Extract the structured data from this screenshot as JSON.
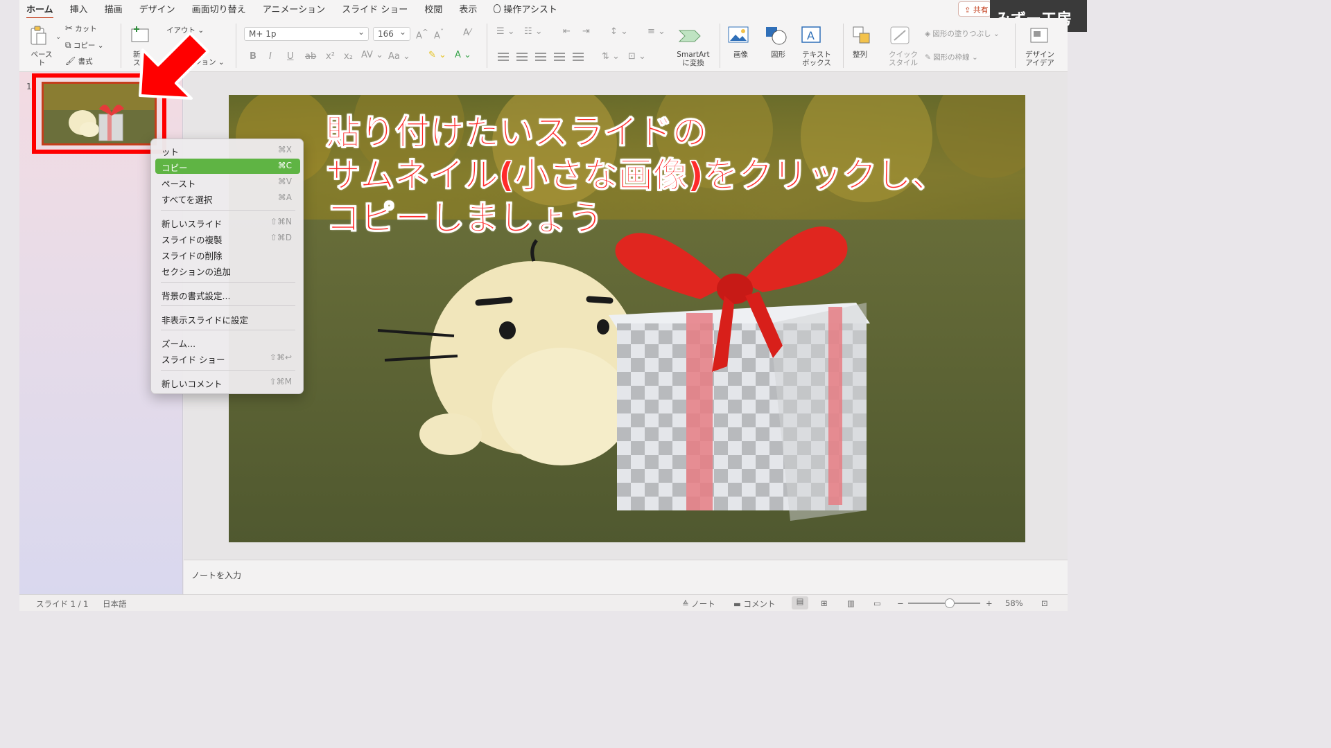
{
  "tabs": [
    {
      "label": "ホーム",
      "active": true
    },
    {
      "label": "挿入"
    },
    {
      "label": "描画"
    },
    {
      "label": "デザイン"
    },
    {
      "label": "画面切り替え"
    },
    {
      "label": "アニメーション"
    },
    {
      "label": "スライド ショー"
    },
    {
      "label": "校閲"
    },
    {
      "label": "表示"
    }
  ],
  "assist_label": "操作アシスト",
  "share_label": "共有",
  "watermark": "みずー工房",
  "ribbon": {
    "paste": "ペースト",
    "cut": "カット",
    "copy": "コピー",
    "format": "書式",
    "new_slide_fragment": "新",
    "new_slide_fragment2": "ス",
    "layout_fragment": "イアウト",
    "section_fragment": "ション",
    "font_name": "M+ 1p",
    "font_size": "166",
    "smartart": "SmartArt\nに変換",
    "image": "画像",
    "shape": "図形",
    "textbox": "テキスト\nボックス",
    "arrange": "整列",
    "quick_style": "クイック\nスタイル",
    "shape_fill": "図形の塗りつぶし",
    "shape_outline": "図形の枠線",
    "design_ideas": "デザイン\nアイデア"
  },
  "slide_number": "1",
  "slide_title": "貼り付けたいスライドの\nサムネイル(小さな画像)をクリックし、\nコピーしましょう",
  "notes_placeholder": "ノートを入力",
  "status": {
    "slide_count": "スライド 1 / 1",
    "language": "日本語",
    "notes": "ノート",
    "comments": "コメント",
    "zoom": "58%",
    "zoom_level": 0.58
  },
  "context_menu": [
    {
      "label": "カット",
      "shortcut": "⌘X",
      "display": "ット"
    },
    {
      "label": "コピー",
      "shortcut": "⌘C",
      "active": true
    },
    {
      "label": "ペースト",
      "shortcut": "⌘V"
    },
    {
      "label": "すべてを選択",
      "shortcut": "⌘A"
    },
    {
      "label": "新しいスライド",
      "shortcut": "⇧⌘N"
    },
    {
      "label": "スライドの複製",
      "shortcut": "⇧⌘D"
    },
    {
      "label": "スライドの削除",
      "shortcut": ""
    },
    {
      "label": "セクションの追加",
      "shortcut": ""
    },
    {
      "label": "背景の書式設定...",
      "shortcut": ""
    },
    {
      "label": "非表示スライドに設定",
      "shortcut": ""
    },
    {
      "label": "ズーム...",
      "shortcut": ""
    },
    {
      "label": "スライド ショー",
      "shortcut": "⇧⌘↩"
    },
    {
      "label": "新しいコメント",
      "shortcut": "⇧⌘M"
    }
  ],
  "colors": {
    "accent": "#c43e1c",
    "highlight": "#ff0000",
    "menu_active": "#5fb444"
  }
}
